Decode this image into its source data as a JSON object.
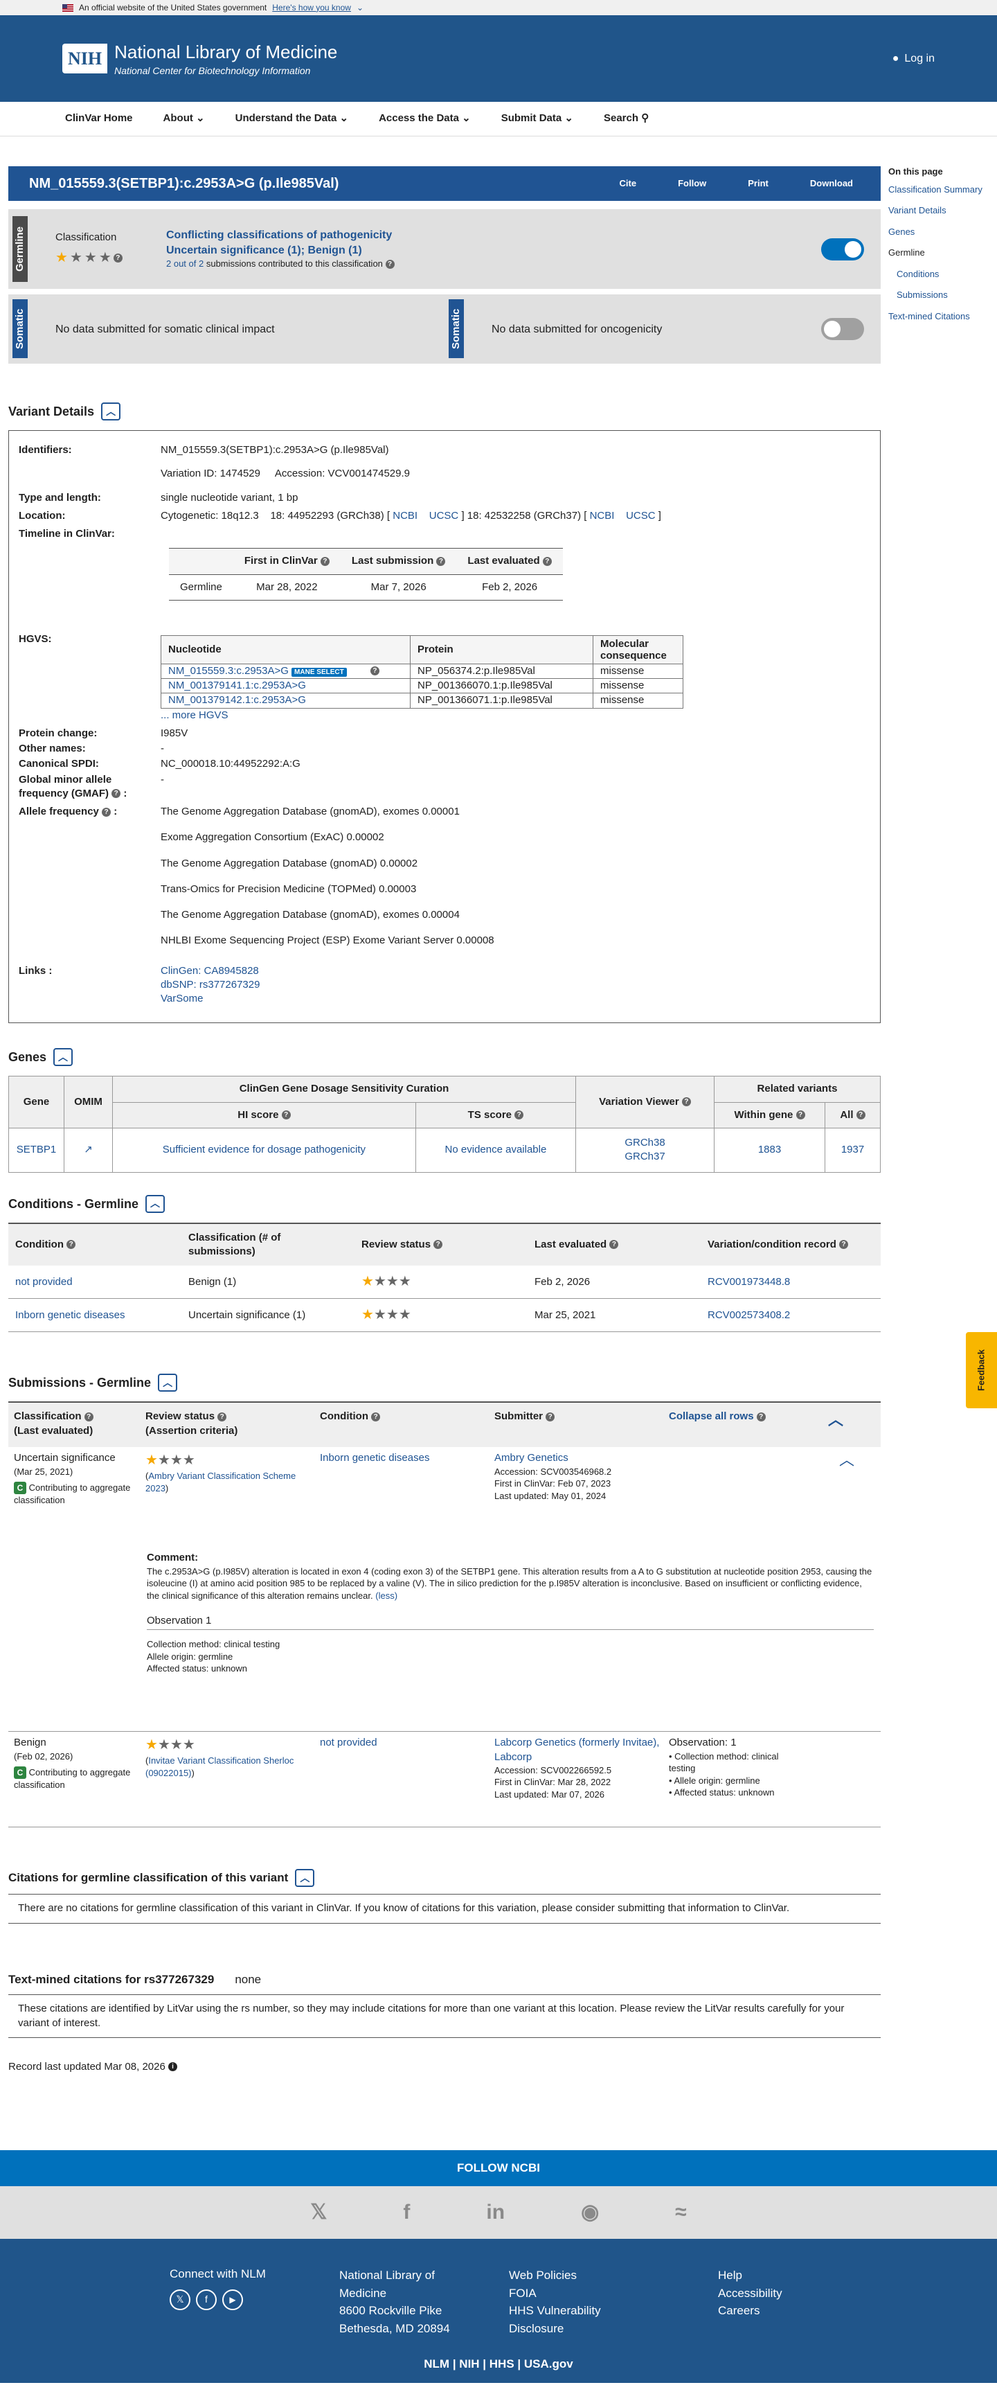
{
  "gov": {
    "text": "An official website of the United States government",
    "how": "Here's how you know"
  },
  "brand": {
    "nih": "NIH",
    "title": "National Library of Medicine",
    "subtitle": "National Center for Biotechnology Information",
    "login": "Log in"
  },
  "nav": {
    "home": "ClinVar Home",
    "about": "About",
    "understand": "Understand the Data",
    "access": "Access the Data",
    "submit": "Submit Data",
    "search": "Search"
  },
  "title": {
    "text": "NM_015559.3(SETBP1):c.2953A>G (p.Ile985Val)",
    "cite": "Cite",
    "follow": "Follow",
    "print": "Print",
    "download": "Download"
  },
  "sidebar": {
    "heading": "On this page",
    "items": [
      "Classification Summary",
      "Variant Details",
      "Genes",
      "Germline",
      "Conditions",
      "Submissions",
      "Text-mined Citations"
    ]
  },
  "germline": {
    "tag": "Germline",
    "cls_label": "Classification",
    "line1": "Conflicting classifications of pathogenicity",
    "line2": "Uncertain significance (1); Benign (1)",
    "count": "2 out of 2",
    "count_rest": "submissions contributed to this classification"
  },
  "somatic": {
    "tag": "Somatic",
    "clinical": "No data submitted for somatic clinical impact",
    "onco": "No data submitted for oncogenicity"
  },
  "variant": {
    "heading": "Variant Details",
    "ids_k": "Identifiers:",
    "ids_v": "NM_015559.3(SETBP1):c.2953A>G (p.Ile985Val)",
    "var_id": "Variation ID: 1474529",
    "accession": "Accession: VCV001474529.9",
    "type_k": "Type and length:",
    "type_v": "single nucleotide variant, 1 bp",
    "loc_k": "Location:",
    "loc_cyto": "Cytogenetic: 18q12.3",
    "loc_38": "18: 44952293 (GRCh38) [",
    "ncbi": "NCBI",
    "ucsc": "UCSC",
    "loc_37": "] 18: 42532258 (GRCh37) [",
    "loc_end": "]",
    "timeline_k": "Timeline in ClinVar:",
    "tl_headers": [
      "First in ClinVar",
      "Last submission",
      "Last evaluated"
    ],
    "tl_row": [
      "Germline",
      "Mar 28, 2022",
      "Mar 7, 2026",
      "Feb 2, 2026"
    ],
    "hgvs_k": "HGVS:",
    "hgvs_headers": [
      "Nucleotide",
      "Protein",
      "Molecular consequence"
    ],
    "hgvs_rows": [
      [
        "NM_015559.3:c.2953A>G",
        "NP_056374.2:p.Ile985Val",
        "missense"
      ],
      [
        "NM_001379141.1:c.2953A>G",
        "NP_001366070.1:p.Ile985Val",
        "missense"
      ],
      [
        "NM_001379142.1:c.2953A>G",
        "NP_001366071.1:p.Ile985Val",
        "missense"
      ]
    ],
    "mane": "MANE SELECT",
    "more": "... more HGVS",
    "pc_k": "Protein change:",
    "pc_v": "I985V",
    "on_k": "Other names:",
    "on_v": "-",
    "spdi_k": "Canonical SPDI:",
    "spdi_v": "NC_000018.10:44952292:A:G",
    "gmaf_k": "Global minor allele frequency (GMAF)",
    "gmaf_v": "-",
    "af_k": "Allele frequency",
    "freqs": [
      "The Genome Aggregation Database (gnomAD), exomes 0.00001",
      "Exome Aggregation Consortium (ExAC) 0.00002",
      "The Genome Aggregation Database (gnomAD) 0.00002",
      "Trans-Omics for Precision Medicine (TOPMed) 0.00003",
      "The Genome Aggregation Database (gnomAD), exomes 0.00004",
      "NHLBI Exome Sequencing Project (ESP) Exome Variant Server 0.00008"
    ],
    "links_k": "Links :",
    "links": [
      "ClinGen: CA8945828",
      "dbSNP: rs377267329",
      "VarSome"
    ]
  },
  "genes": {
    "heading": "Genes",
    "h": {
      "gene": "Gene",
      "omim": "OMIM",
      "clingen": "ClinGen Gene Dosage Sensitivity Curation",
      "hi": "HI score",
      "ts": "TS score",
      "viewer": "Variation Viewer",
      "related": "Related variants",
      "within": "Within gene",
      "all": "All"
    },
    "row": {
      "gene": "SETBP1",
      "hi": "Sufficient evidence for dosage pathogenicity",
      "ts": "No evidence available",
      "grch38": "GRCh38",
      "grch37": "GRCh37",
      "within": "1883",
      "all": "1937"
    }
  },
  "conditions": {
    "heading": "Conditions - Germline",
    "headers": [
      "Condition",
      "Classification (# of submissions)",
      "Review status",
      "Last evaluated",
      "Variation/condition record"
    ],
    "rows": [
      [
        "not provided",
        "Benign (1)",
        "Feb 2, 2026",
        "RCV001973448.8"
      ],
      [
        "Inborn genetic diseases",
        "Uncertain significance (1)",
        "Mar 25, 2021",
        "RCV002573408.2"
      ]
    ]
  },
  "submissions": {
    "heading": "Submissions - Germline",
    "h_cls": "Classification",
    "h_cls2": "(Last evaluated)",
    "h_rev": "Review status",
    "h_rev2": "(Assertion criteria)",
    "h_cond": "Condition",
    "h_sub": "Submitter",
    "collapse": "Collapse all rows",
    "s1": {
      "cls": "Uncertain significance",
      "date": "(Mar 25, 2021)",
      "contrib": "Contributing to aggregate classification",
      "criteria": "Ambry Variant Classification Scheme 2023",
      "condition": "Inborn genetic diseases",
      "submitter": "Ambry Genetics",
      "acc": "Accession: SCV003546968.2",
      "first": "First in ClinVar: Feb 07, 2023",
      "last": "Last updated: May 01, 2024",
      "comment_h": "Comment:",
      "comment": "The c.2953A>G (p.I985V) alteration is located in exon 4 (coding exon 3) of the SETBP1 gene. This alteration results from a A to G substitution at nucleotide position 2953, causing the isoleucine (I) at amino acid position 985 to be replaced by a valine (V). The in silico prediction for the p.I985V alteration is inconclusive. Based on insufficient or conflicting evidence, the clinical significance of this alteration remains unclear.",
      "less": "(less)",
      "obs_h": "Observation 1",
      "obs": [
        "Collection method: clinical testing",
        "Allele origin: germline",
        "Affected status: unknown"
      ]
    },
    "s2": {
      "cls": "Benign",
      "date": "(Feb 02, 2026)",
      "contrib": "Contributing to aggregate classification",
      "criteria": "Invitae Variant Classification Sherloc (09022015)",
      "condition": "not provided",
      "submitter": "Labcorp Genetics (formerly Invitae), Labcorp",
      "acc": "Accession: SCV002266592.5",
      "first": "First in ClinVar: Mar 28, 2022",
      "last": "Last updated: Mar 07, 2026",
      "obs_h": "Observation: 1",
      "obs": [
        "Collection method: clinical testing",
        "Allele origin: germline",
        "Affected status: unknown"
      ]
    }
  },
  "citations": {
    "heading": "Citations for germline classification of this variant",
    "text": "There are no citations for germline classification of this variant in ClinVar. If you know of citations for this variation, please consider submitting that information to ClinVar."
  },
  "textmined": {
    "heading": "Text-mined citations for rs377267329",
    "none": "none",
    "text": "These citations are identified by LitVar using the rs number, so they may include citations for more than one variant at this location. Please review the LitVar results carefully for your variant of interest."
  },
  "record": "Record last updated Mar 08, 2026",
  "feedback": "Feedback",
  "footer": {
    "follow": "FOLLOW NCBI",
    "connect": "Connect with NLM",
    "addr": [
      "National Library of",
      "Medicine",
      "8600 Rockville Pike",
      "Bethesda, MD 20894"
    ],
    "col2": [
      "Web Policies",
      "FOIA",
      "HHS Vulnerability",
      "Disclosure"
    ],
    "col3": [
      "Help",
      "Accessibility",
      "Careers"
    ],
    "bottom": [
      "NLM",
      "NIH",
      "HHS",
      "USA.gov"
    ],
    "social_icons": [
      "x-icon",
      "facebook-icon",
      "linkedin-icon",
      "github-icon",
      "rss-icon"
    ]
  }
}
